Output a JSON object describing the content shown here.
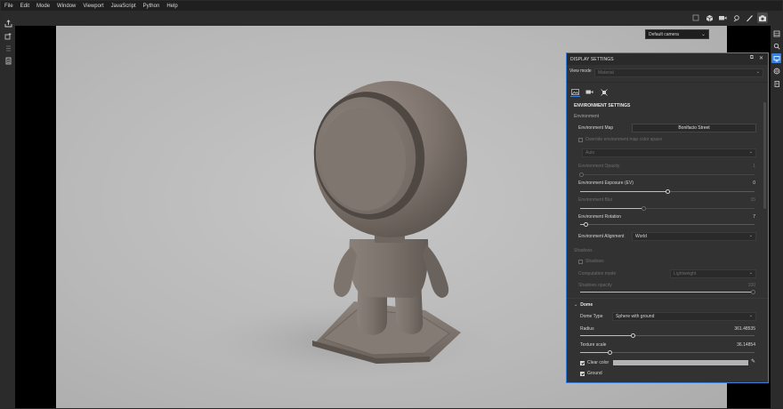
{
  "menu": [
    "File",
    "Edit",
    "Mode",
    "Window",
    "Viewport",
    "JavaScript",
    "Python",
    "Help"
  ],
  "viewport": {
    "camera_select": "Default camera"
  },
  "panel": {
    "title": "DISPLAY SETTINGS",
    "view_mode_label": "View mode",
    "view_mode_value": "Material",
    "section_title": "ENVIRONMENT SETTINGS",
    "environment_label": "Environment",
    "env_map_label": "Environment Map",
    "env_map_value": "Bonifacio Street",
    "override_label": "Override environment map color space",
    "color_space_value": "Auto",
    "env_opacity_label": "Environment Opacity",
    "env_opacity_value": "1",
    "env_opacity_fraction": 0.0,
    "env_exposure_label": "Environment Exposure (EV)",
    "env_exposure_value": "0",
    "env_exposure_fraction": 0.5,
    "env_blur_label": "Environment Blur",
    "env_blur_value": "15",
    "env_blur_fraction": 0.36,
    "env_rotation_label": "Environment Rotation",
    "env_rotation_value": "7",
    "env_rotation_fraction": 0.03,
    "env_alignment_label": "Environment Alignment",
    "env_alignment_value": "World",
    "shadows_title": "Shadows",
    "shadows_check_label": "Shadows",
    "computation_mode_label": "Computation mode",
    "computation_mode_value": "Lightweight",
    "shadows_opacity_label": "Shadows opacity",
    "shadows_opacity_value": "100",
    "shadows_opacity_fraction": 1.0,
    "dome_title": "Dome",
    "dome_type_label": "Dome Type",
    "dome_type_value": "Sphere with ground",
    "radius_label": "Radius",
    "radius_value": "361.48535",
    "radius_fraction": 0.3,
    "texture_scale_label": "Texture scale",
    "texture_scale_value": "36.14854",
    "texture_scale_fraction": 0.17,
    "clear_color_label": "Clear color",
    "ground_label": "Ground"
  }
}
